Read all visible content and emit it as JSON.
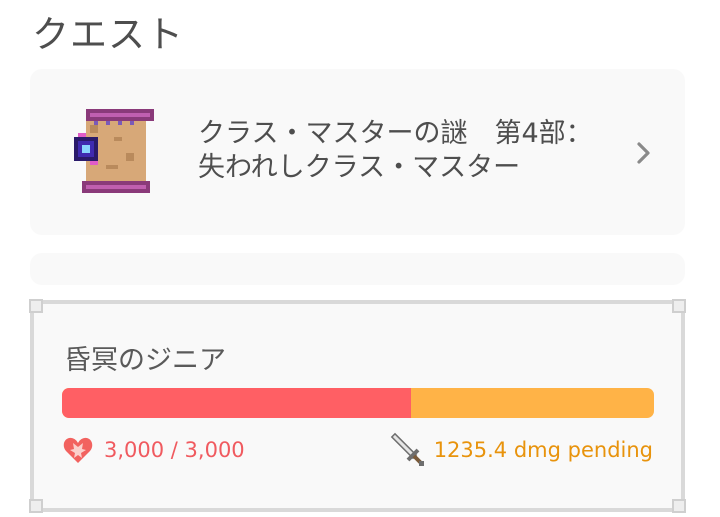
{
  "section": {
    "title": "クエスト"
  },
  "quest": {
    "title_line1": "クラス・マスターの謎　第4部：",
    "title_line2": "失われしクラス・マスター",
    "icon": "scroll-icon"
  },
  "boss": {
    "name": "昏冥のジニア",
    "hp_text": "3,000 / 3,000",
    "hp_fraction": 0.59,
    "damage_text": "1235.4 dmg pending",
    "colors": {
      "hp": "#ff5f64",
      "pending": "#ffb347",
      "damage_text": "#e8930c"
    }
  }
}
